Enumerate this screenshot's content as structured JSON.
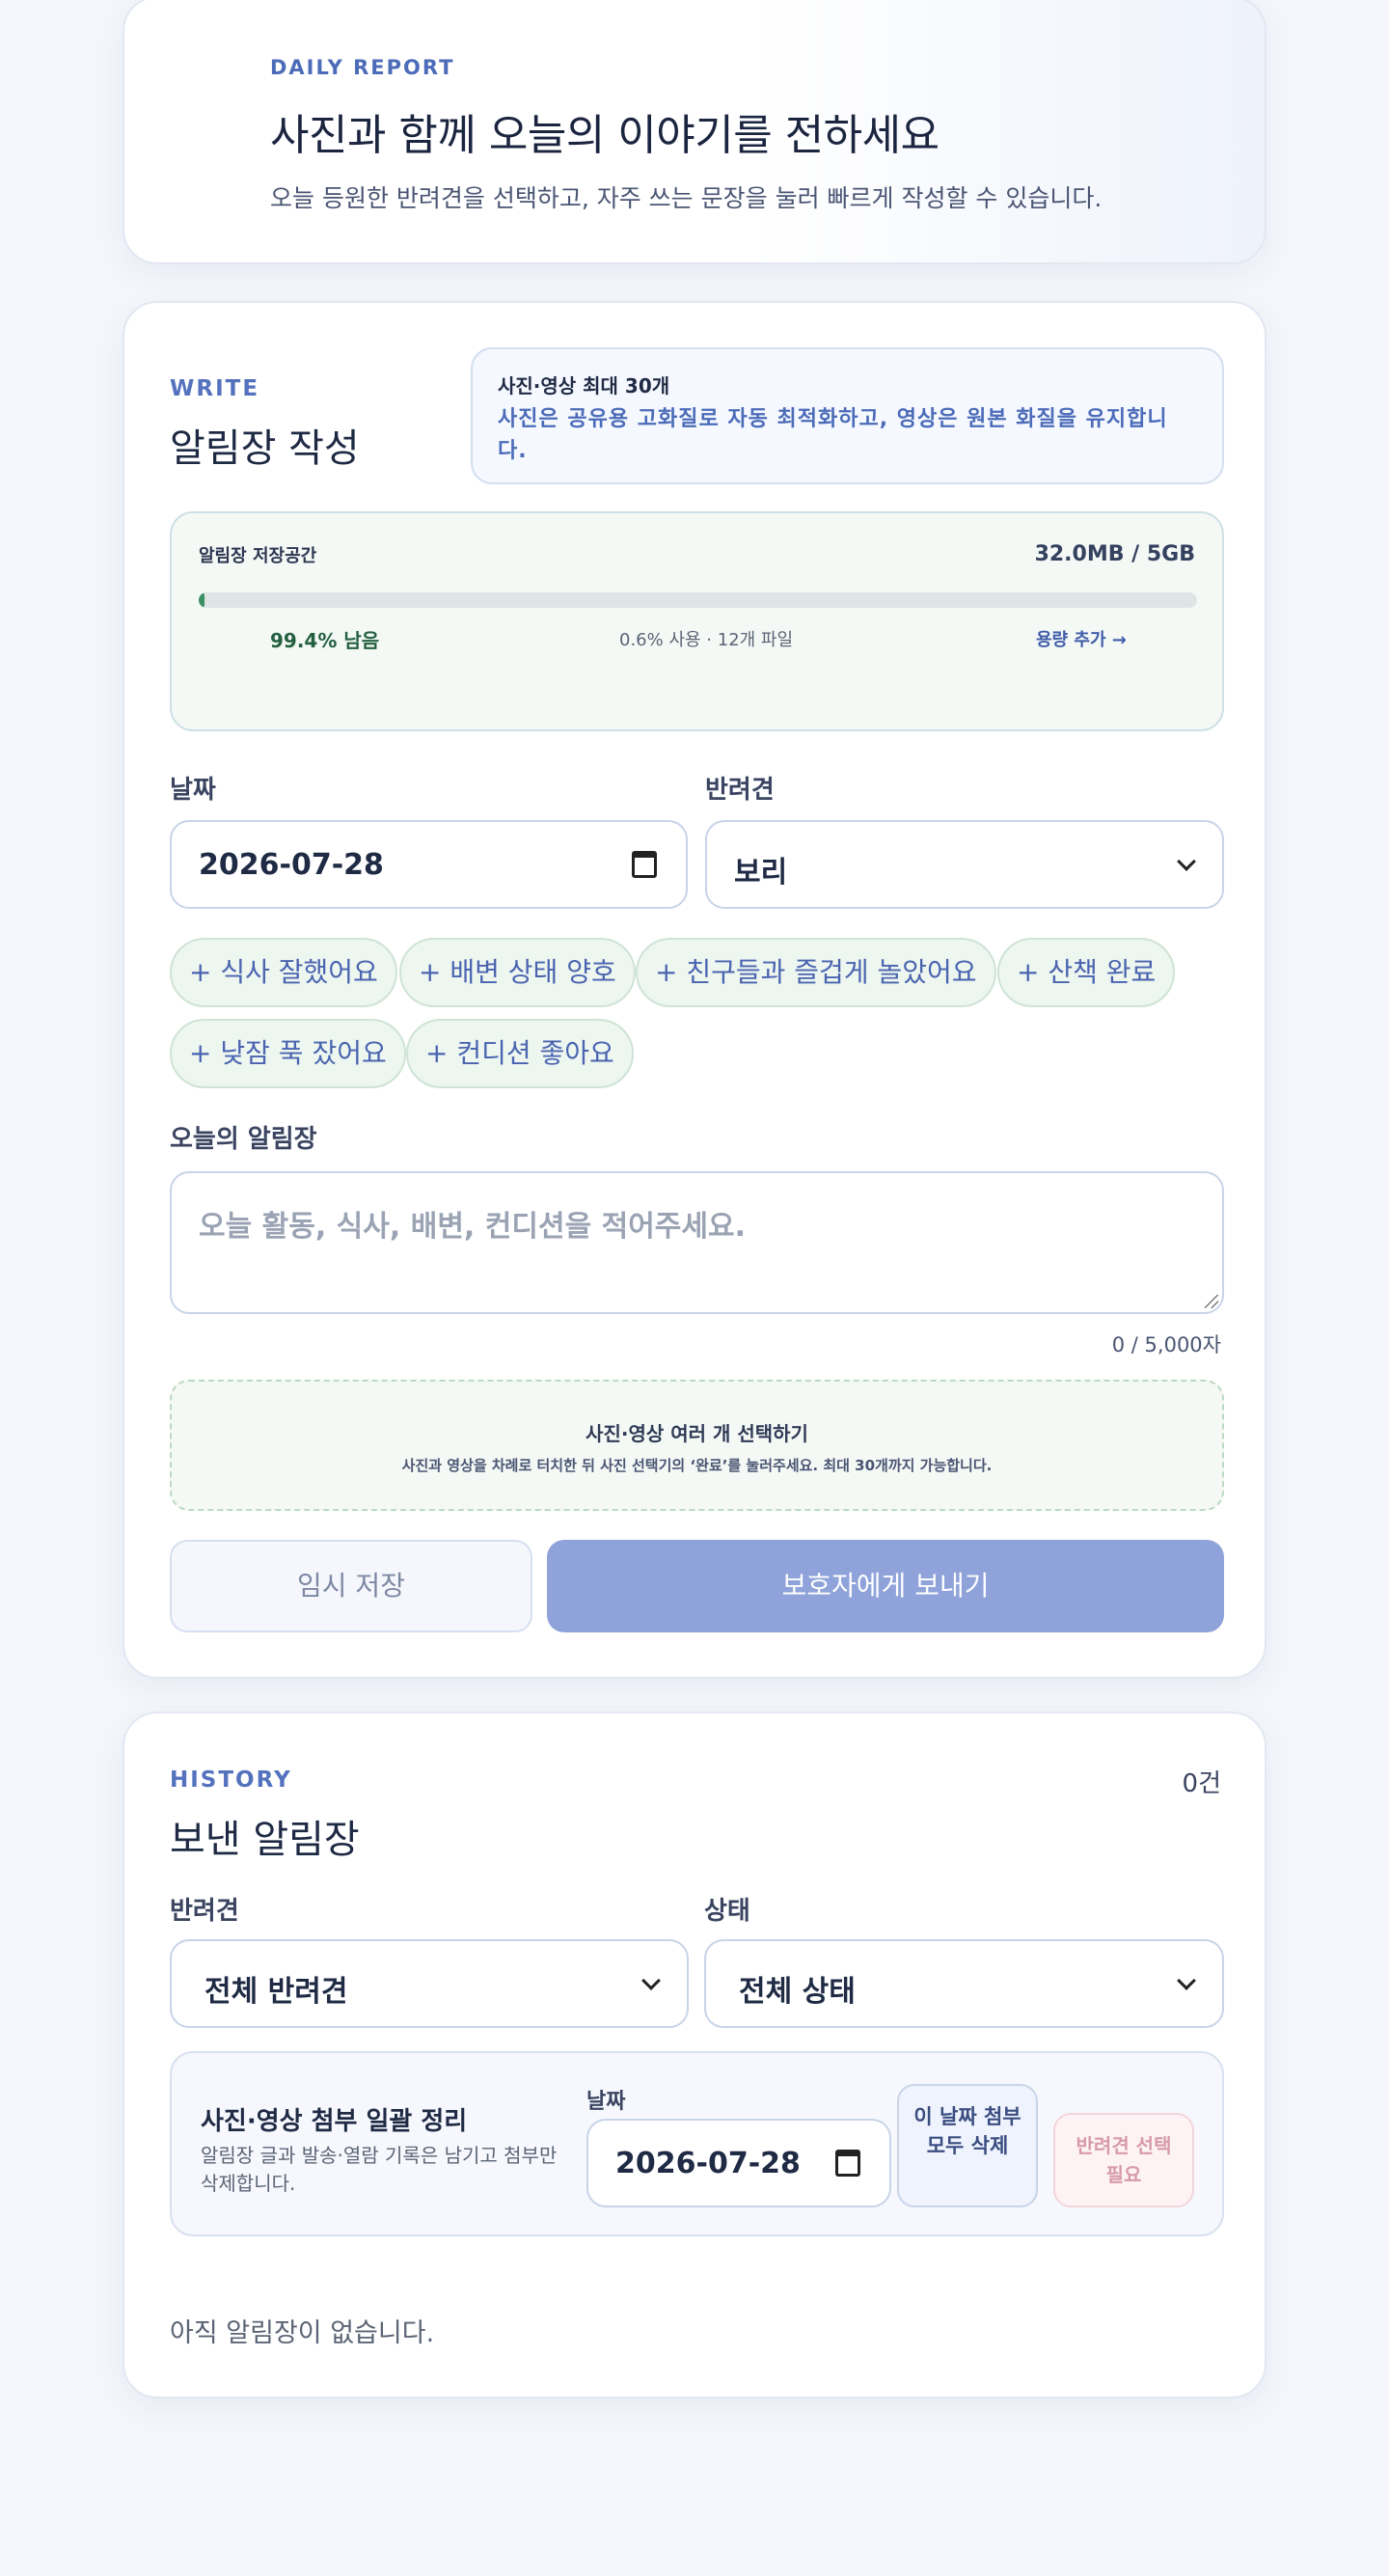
{
  "hero": {
    "eyebrow": "DAILY REPORT",
    "title": "사진과 함께 오늘의 이야기를 전하세요",
    "subtitle": "오늘 등원한 반려견을 선택하고, 자주 쓰는 문장을 눌러 빠르게 작성할 수 있습니다."
  },
  "write": {
    "eyebrow": "WRITE",
    "title": "알림장 작성",
    "notice": {
      "title": "사진·영상 최대 30개",
      "body": "사진은 공유용 고화질로 자동 최적화하고, 영상은 원본 화질을 유지합니다."
    },
    "storage": {
      "label": "알림장 저장공간",
      "total": "32.0MB / 5GB",
      "used_fraction": 0.006,
      "remaining": "99.4% 남음",
      "usage": "0.6% 사용 · 12개 파일",
      "add_link": "용량 추가 →"
    },
    "date_label": "날짜",
    "date_value": "2026-07-28",
    "dog_label": "반려견",
    "dog_value": "보리",
    "chips": [
      "+ 식사 잘했어요",
      "+ 배변 상태 양호",
      "+ 친구들과 즐겁게 놀았어요",
      "+ 산책 완료",
      "+ 낮잠 푹 잤어요",
      "+ 컨디션 좋아요"
    ],
    "note_label": "오늘의 알림장",
    "note_placeholder": "오늘 활동, 식사, 배변, 컨디션을 적어주세요.",
    "counter": "0 / 5,000자",
    "upload": {
      "title": "사진·영상 여러 개 선택하기",
      "subtitle": "사진과 영상을 차례로 터치한 뒤 사진 선택기의 ‘완료’를 눌러주세요. 최대 30개까지 가능합니다."
    },
    "draft_button": "임시 저장",
    "send_button": "보호자에게 보내기"
  },
  "history": {
    "eyebrow": "HISTORY",
    "title": "보낸 알림장",
    "count": "0건",
    "dog_filter_label": "반려견",
    "dog_filter_value": "전체 반려견",
    "status_filter_label": "상태",
    "status_filter_value": "전체 상태",
    "bulk": {
      "title": "사진·영상 첨부 일괄 정리",
      "desc": "알림장 글과 발송·열람 기록은 남기고 첨부만 삭제합니다.",
      "date_label": "날짜",
      "date_value": "2026-07-28",
      "delete_button": "이 날짜 첨부 모두 삭제",
      "need_dog": "반려견 선택 필요"
    },
    "empty": "아직 알림장이 없습니다."
  },
  "icons": [
    "calendar-icon",
    "chevron-down-icon",
    "resize-handle-icon"
  ],
  "colors": {
    "accent": "#4c6cb9",
    "send_button": "#8fa3da",
    "storage_fill": "#3d8f66",
    "chip_bg": "#eef6f0"
  }
}
